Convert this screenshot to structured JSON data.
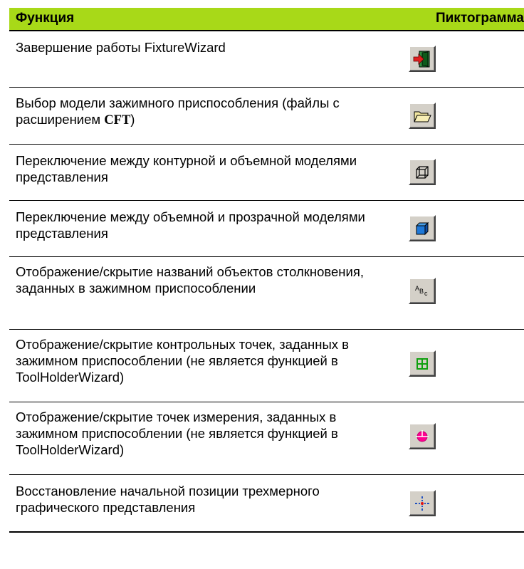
{
  "header": {
    "function_label": "Функция",
    "icon_label": "Пиктограмма"
  },
  "rows": [
    {
      "text": "Завершение работы FixtureWizard",
      "icon": "exit-door-icon"
    },
    {
      "text_before": "Выбор модели зажимного приспособления (файлы с расширением ",
      "text_bold": "CFT",
      "text_after": ")",
      "icon": "open-folder-icon"
    },
    {
      "text": "Переключение между контурной и объемной моделями представления",
      "icon": "wireframe-cube-icon"
    },
    {
      "text": "Переключение между объемной и прозрачной моделями представления",
      "icon": "solid-cube-icon"
    },
    {
      "text": "Отображение/скрытие названий объектов столкновения, заданных в зажимном приспособлении",
      "icon": "abc-labels-icon"
    },
    {
      "text": "Отображение/скрытие контрольных точек, заданных в зажимном приспособлении (не является функцией в ToolHolderWizard)",
      "icon": "green-grid-icon"
    },
    {
      "text": "Отображение/скрытие точек измерения, заданных в зажимном приспособлении (не является функцией в ToolHolderWizard)",
      "icon": "measure-point-icon"
    },
    {
      "text": "Восстановление начальной позиции трехмерного графического представления",
      "icon": "reset-view-icon"
    }
  ],
  "colors": {
    "header_bg": "#a8d918",
    "button_face": "#d4d0c8"
  }
}
